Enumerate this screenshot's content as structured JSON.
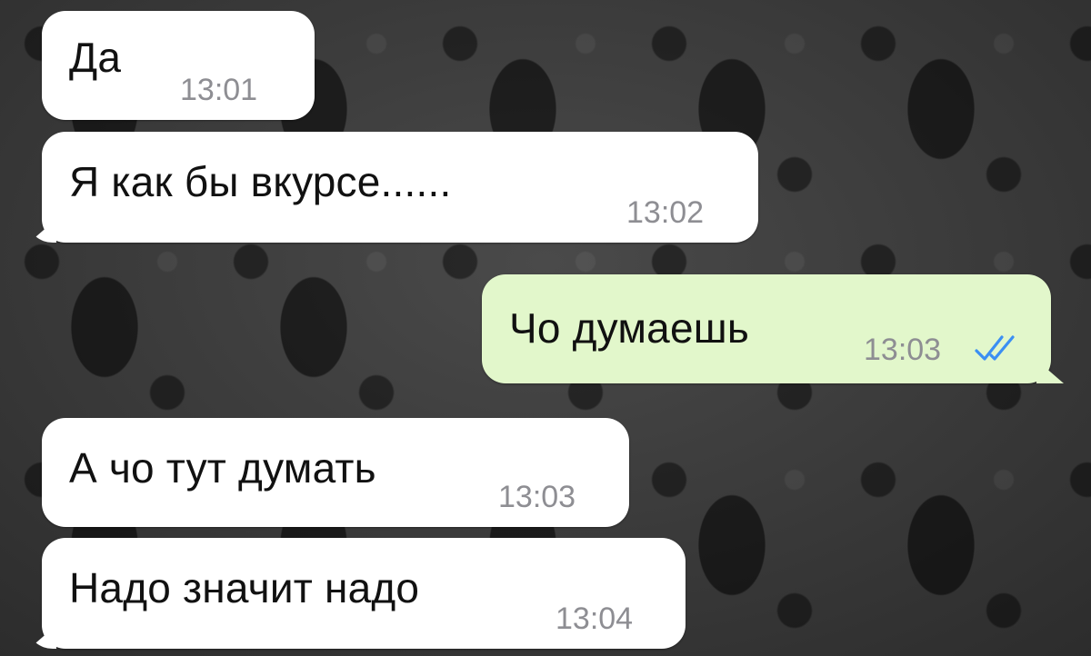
{
  "messages": [
    {
      "text": "Да",
      "time": "13:01",
      "direction": "incoming"
    },
    {
      "text": "Я как бы вкурсе......",
      "time": "13:02",
      "direction": "incoming"
    },
    {
      "text": "Чо думаешь",
      "time": "13:03",
      "direction": "outgoing",
      "status": "read",
      "status_icon": "double-check-icon",
      "status_color": "#3b8ff3"
    },
    {
      "text": "А чо тут думать",
      "time": "13:03",
      "direction": "incoming"
    },
    {
      "text": "Надо значит надо",
      "time": "13:04",
      "direction": "incoming"
    }
  ],
  "colors": {
    "incoming_bubble": "#ffffff",
    "outgoing_bubble": "#e2f7cb",
    "timestamp": "#8e8e93",
    "read_ticks": "#3b8ff3"
  }
}
